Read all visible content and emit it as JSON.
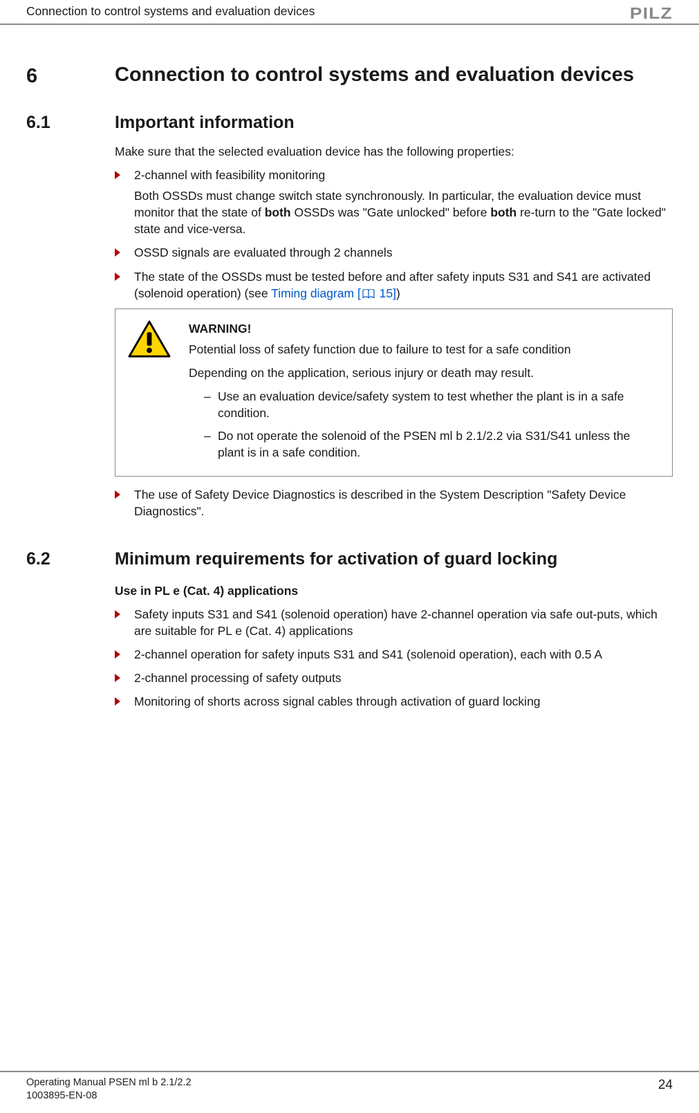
{
  "header": {
    "running_title": "Connection to control systems and evaluation devices",
    "logo_text": "PILZ"
  },
  "section6": {
    "number": "6",
    "title": "Connection to control systems and evaluation devices"
  },
  "section6_1": {
    "number": "6.1",
    "title": "Important information",
    "intro": "Make sure that the selected evaluation device has the following properties:",
    "bullets": [
      {
        "lead": "2-channel with feasibility monitoring",
        "follow_prefix": "Both OSSDs must change switch state synchronously. In particular, the evaluation device must monitor that the state of ",
        "b1": "both",
        "mid": " OSSDs was \"Gate unlocked\" before ",
        "b2": "both",
        "suffix": " re-turn to the \"Gate locked\" state and vice-versa."
      },
      {
        "lead": "OSSD signals are evaluated through 2 channels"
      },
      {
        "lead_prefix": "The state of the OSSDs must be tested before and after safety inputs S31 and S41 are activated (solenoid operation) (see ",
        "link_text": "Timing diagram [",
        "link_page": " 15]",
        "lead_suffix": ")"
      }
    ],
    "warning": {
      "title": "WARNING!",
      "p1": "Potential loss of safety function due to failure to test for a safe condition",
      "p2": "Depending on the application, serious injury or death may result.",
      "items": [
        "Use an evaluation device/safety system to test whether the plant is in a safe condition.",
        "Do not operate the solenoid of the PSEN ml b 2.1/2.2 via S31/S41 unless the plant is in a safe condition."
      ]
    },
    "post_bullet": "The use of Safety Device Diagnostics is described in the System Description \"Safety Device Diagnostics\"."
  },
  "section6_2": {
    "number": "6.2",
    "title": "Minimum requirements for activation of guard locking",
    "subhead": "Use in PL e (Cat. 4) applications",
    "bullets": [
      "Safety inputs S31 and S41 (solenoid operation) have 2-channel operation via safe out-puts, which are suitable for PL e (Cat. 4) applications",
      "2-channel operation for safety inputs S31 and S41 (solenoid operation), each with 0.5 A",
      "2-channel processing of safety outputs",
      "Monitoring of shorts across signal cables through activation of guard locking"
    ]
  },
  "footer": {
    "line1": "Operating Manual PSEN ml b 2.1/2.2",
    "line2": "1003895-EN-08",
    "page": "24"
  }
}
